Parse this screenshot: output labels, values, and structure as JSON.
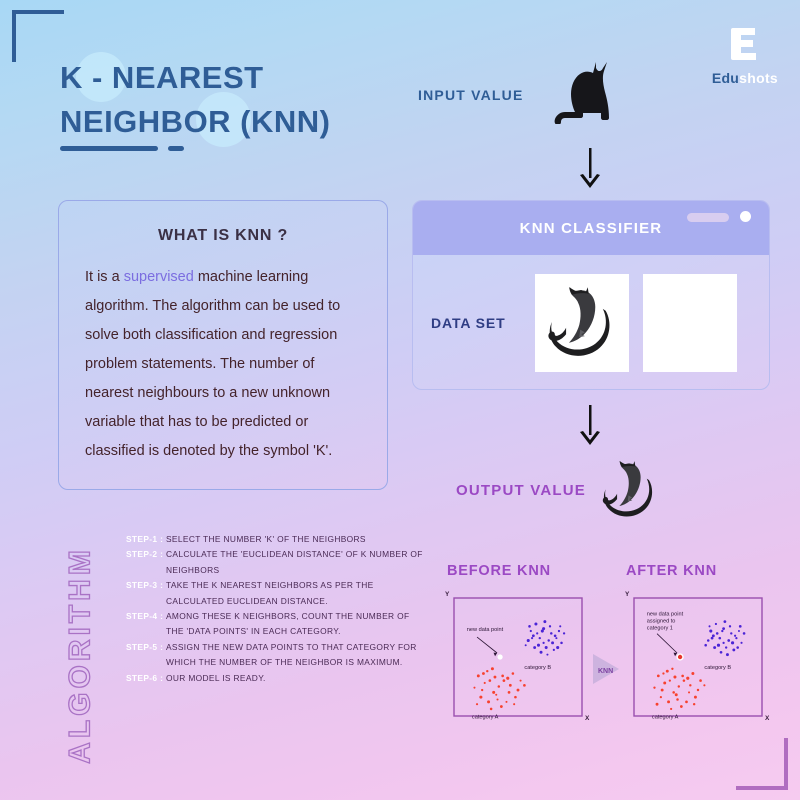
{
  "brand": {
    "logo_mark": "e-letter-mark",
    "name_part1": "Edu",
    "name_part2": "shots"
  },
  "header": {
    "title_line1": "K - NEAREST",
    "title_line2": "NEIGHBOR (KNN)",
    "title_color": "#2f5d96"
  },
  "flow": {
    "input_label": "INPUT VALUE",
    "input_icon": "cat-silhouette-icon",
    "arrow_down_1": "arrow-down-icon",
    "arrow_down_2": "arrow-down-icon",
    "output_label": "OUTPUT VALUE",
    "output_icon": "ink-cat-image",
    "output_color": "#9b49c4"
  },
  "what_is_knn": {
    "title": "WHAT IS KNN ?",
    "body_before": "It is a ",
    "highlight": "supervised",
    "body_after": " machine learning algorithm. The algorithm can be used to solve both classification and regression problem statements. The number of nearest neighbours to a new unknown variable that has to be predicted or classified is denoted by the symbol 'K'.",
    "highlight_color": "#7b6de0"
  },
  "classifier": {
    "title": "KNN CLASSIFIER",
    "dataset_label": "DATA SET",
    "header_color": "#a9aef0",
    "controls": [
      "window-pill",
      "window-dot"
    ],
    "images": [
      "ink-cat-image",
      "empty-image"
    ]
  },
  "algorithm": {
    "heading": "ALGORITHM",
    "heading_color": "#a972c5",
    "steps": [
      {
        "tag": "STEP-1 :",
        "text": "SELECT THE NUMBER 'K' OF THE NEIGHBORS"
      },
      {
        "tag": "STEP-2 :",
        "text": "CALCULATE THE 'EUCLIDEAN DISTANCE' OF K NUMBER OF NEIGHBORS"
      },
      {
        "tag": "STEP-3 :",
        "text": "TAKE THE K NEAREST NEIGHBORS AS PER THE CALCULATED EUCLIDEAN DISTANCE."
      },
      {
        "tag": "STEP-4 :",
        "text": "AMONG THESE K NEIGHBORS, COUNT THE NUMBER OF THE 'DATA POINTS' IN EACH CATEGORY."
      },
      {
        "tag": "STEP-5 :",
        "text": "ASSIGN THE NEW DATA POINTS TO THAT CATEGORY FOR WHICH THE NUMBER OF THE NEIGHBOR IS MAXIMUM."
      },
      {
        "tag": "STEP-6 :",
        "text": "OUR MODEL IS READY."
      }
    ]
  },
  "comparison": {
    "before_label": "BEFORE KNN",
    "after_label": "AFTER KNN",
    "mid_arrow_label": "KNN",
    "axis_x": "X",
    "axis_y": "Y",
    "before_annotation": "new data point",
    "after_annotation_line1": "new data point",
    "after_annotation_line2": "assigned to",
    "after_annotation_line3": "category 1",
    "category_a_label": "category A",
    "category_b_label": "category B",
    "category_a_color": "#f7412e",
    "category_b_color": "#4b24d6",
    "new_point_before_color": "#ffffff",
    "new_point_after_color": "#e8342a"
  },
  "chart_data": [
    {
      "type": "scatter",
      "title": "BEFORE KNN",
      "xlabel": "X",
      "ylabel": "Y",
      "grid": false,
      "legend": "inline-labels",
      "series": [
        {
          "name": "category A",
          "color": "#f7412e",
          "points": [
            [
              22,
              22
            ],
            [
              28,
              30
            ],
            [
              33,
              18
            ],
            [
              38,
              34
            ],
            [
              27,
              12
            ],
            [
              44,
              26
            ],
            [
              19,
              34
            ],
            [
              35,
              25
            ],
            [
              48,
              16
            ],
            [
              30,
              40
            ],
            [
              41,
              12
            ],
            [
              24,
              28
            ],
            [
              52,
              30
            ],
            [
              16,
              24
            ],
            [
              37,
              8
            ],
            [
              46,
              36
            ],
            [
              21,
              16
            ],
            [
              32,
              33
            ],
            [
              43,
              20
            ],
            [
              26,
              38
            ],
            [
              50,
              22
            ],
            [
              29,
              6
            ],
            [
              39,
              30
            ],
            [
              18,
              10
            ],
            [
              55,
              26
            ],
            [
              34,
              14
            ],
            [
              23,
              36
            ],
            [
              47,
              10
            ],
            [
              42,
              32
            ],
            [
              31,
              20
            ]
          ]
        },
        {
          "name": "category B",
          "color": "#4b24d6",
          "points": [
            [
              62,
              68
            ],
            [
              70,
              74
            ],
            [
              66,
              60
            ],
            [
              76,
              70
            ],
            [
              58,
              64
            ],
            [
              72,
              58
            ],
            [
              80,
              66
            ],
            [
              64,
              78
            ],
            [
              74,
              64
            ],
            [
              68,
              54
            ],
            [
              82,
              72
            ],
            [
              60,
              72
            ],
            [
              78,
              56
            ],
            [
              71,
              80
            ],
            [
              56,
              60
            ],
            [
              84,
              62
            ],
            [
              67,
              66
            ],
            [
              75,
              76
            ],
            [
              63,
              58
            ],
            [
              79,
              68
            ],
            [
              86,
              70
            ],
            [
              69,
              72
            ],
            [
              73,
              52
            ],
            [
              59,
              76
            ],
            [
              81,
              58
            ],
            [
              65,
              70
            ],
            [
              77,
              62
            ],
            [
              61,
              66
            ],
            [
              83,
              76
            ],
            [
              70,
              62
            ]
          ]
        }
      ],
      "annotated_points": [
        {
          "label": "new data point",
          "x": 36,
          "y": 50,
          "color": "#ffffff"
        }
      ]
    },
    {
      "type": "scatter",
      "title": "AFTER KNN",
      "xlabel": "X",
      "ylabel": "Y",
      "grid": false,
      "legend": "inline-labels",
      "series": [
        {
          "name": "category A",
          "color": "#f7412e",
          "points": [
            [
              22,
              22
            ],
            [
              28,
              30
            ],
            [
              33,
              18
            ],
            [
              38,
              34
            ],
            [
              27,
              12
            ],
            [
              44,
              26
            ],
            [
              19,
              34
            ],
            [
              35,
              25
            ],
            [
              48,
              16
            ],
            [
              30,
              40
            ],
            [
              41,
              12
            ],
            [
              24,
              28
            ],
            [
              52,
              30
            ],
            [
              16,
              24
            ],
            [
              37,
              8
            ],
            [
              46,
              36
            ],
            [
              21,
              16
            ],
            [
              32,
              33
            ],
            [
              43,
              20
            ],
            [
              26,
              38
            ],
            [
              50,
              22
            ],
            [
              29,
              6
            ],
            [
              39,
              30
            ],
            [
              18,
              10
            ],
            [
              55,
              26
            ],
            [
              34,
              14
            ],
            [
              23,
              36
            ],
            [
              47,
              10
            ],
            [
              42,
              32
            ],
            [
              31,
              20
            ]
          ]
        },
        {
          "name": "category B",
          "color": "#4b24d6",
          "points": [
            [
              62,
              68
            ],
            [
              70,
              74
            ],
            [
              66,
              60
            ],
            [
              76,
              70
            ],
            [
              58,
              64
            ],
            [
              72,
              58
            ],
            [
              80,
              66
            ],
            [
              64,
              78
            ],
            [
              74,
              64
            ],
            [
              68,
              54
            ],
            [
              82,
              72
            ],
            [
              60,
              72
            ],
            [
              78,
              56
            ],
            [
              71,
              80
            ],
            [
              56,
              60
            ],
            [
              84,
              62
            ],
            [
              67,
              66
            ],
            [
              75,
              76
            ],
            [
              63,
              58
            ],
            [
              79,
              68
            ],
            [
              86,
              70
            ],
            [
              69,
              72
            ],
            [
              73,
              52
            ],
            [
              59,
              76
            ],
            [
              81,
              58
            ],
            [
              65,
              70
            ],
            [
              77,
              62
            ],
            [
              61,
              66
            ],
            [
              83,
              76
            ],
            [
              70,
              62
            ]
          ]
        }
      ],
      "annotated_points": [
        {
          "label": "new data point assigned to category 1",
          "x": 36,
          "y": 50,
          "color": "#e8342a"
        }
      ]
    }
  ],
  "decor": {
    "corner_top_left_color": "#2f5d96",
    "corner_bottom_right_color": "#b06dc0"
  }
}
